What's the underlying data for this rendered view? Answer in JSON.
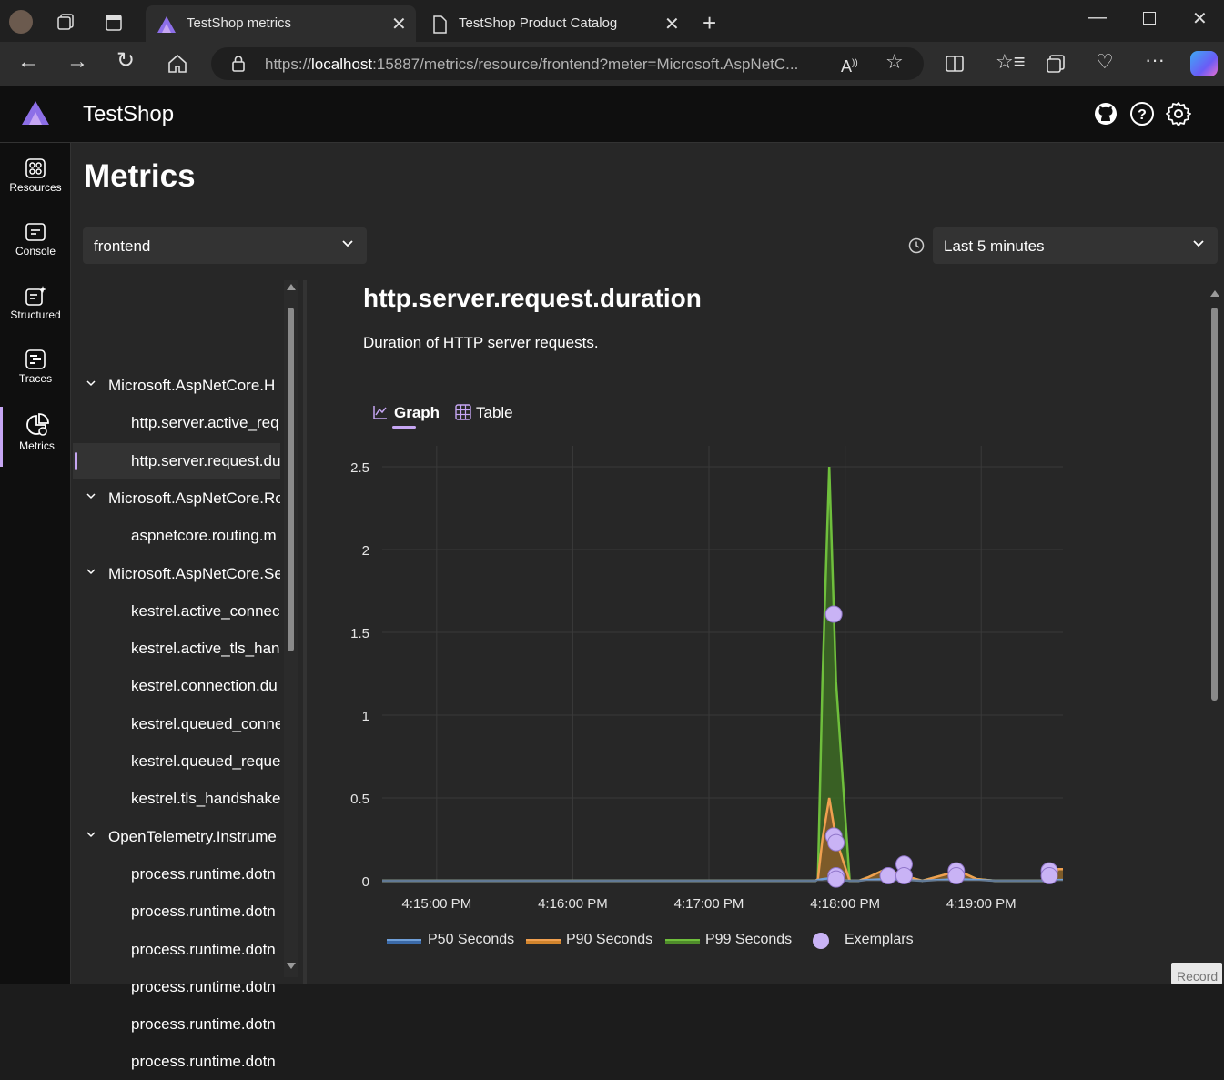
{
  "browser": {
    "tabs": [
      {
        "title": "TestShop metrics",
        "active": true
      },
      {
        "title": "TestShop Product Catalog",
        "active": false
      }
    ],
    "url_prefix": "https://",
    "url_host": "localhost",
    "url_rest": ":15887/metrics/resource/frontend?meter=Microsoft.AspNetC..."
  },
  "app": {
    "title": "TestShop",
    "page_title": "Metrics"
  },
  "nav": {
    "items": [
      {
        "label": "Resources",
        "icon": "resources-icon"
      },
      {
        "label": "Console",
        "icon": "console-icon"
      },
      {
        "label": "Structured",
        "icon": "structured-icon"
      },
      {
        "label": "Traces",
        "icon": "traces-icon"
      },
      {
        "label": "Metrics",
        "icon": "metrics-icon",
        "active": true
      }
    ]
  },
  "resource_select": {
    "value": "frontend"
  },
  "time_select": {
    "value": "Last 5 minutes"
  },
  "tree": [
    {
      "label": "Microsoft.AspNetCore.H",
      "level": 0
    },
    {
      "label": "http.server.active_req",
      "level": 1
    },
    {
      "label": "http.server.request.du",
      "level": 1,
      "selected": true
    },
    {
      "label": "Microsoft.AspNetCore.Ro",
      "level": 0
    },
    {
      "label": "aspnetcore.routing.m",
      "level": 1
    },
    {
      "label": "Microsoft.AspNetCore.Se",
      "level": 0
    },
    {
      "label": "kestrel.active_connec",
      "level": 1
    },
    {
      "label": "kestrel.active_tls_hand",
      "level": 1
    },
    {
      "label": "kestrel.connection.du",
      "level": 1
    },
    {
      "label": "kestrel.queued_conne",
      "level": 1
    },
    {
      "label": "kestrel.queued_reque",
      "level": 1
    },
    {
      "label": "kestrel.tls_handshake",
      "level": 1
    },
    {
      "label": "OpenTelemetry.Instrume",
      "level": 0
    },
    {
      "label": "process.runtime.dotn",
      "level": 1
    },
    {
      "label": "process.runtime.dotn",
      "level": 1
    },
    {
      "label": "process.runtime.dotn",
      "level": 1
    },
    {
      "label": "process.runtime.dotn",
      "level": 1
    },
    {
      "label": "process.runtime.dotn",
      "level": 1
    },
    {
      "label": "process.runtime.dotn",
      "level": 1
    }
  ],
  "metric": {
    "name": "http.server.request.duration",
    "description": "Duration of HTTP server requests."
  },
  "view_tabs": {
    "graph": "Graph",
    "table": "Table"
  },
  "record_label": "Record",
  "colors": {
    "accent": "#c6a6f3",
    "p50": "#3b6aa8",
    "p90": "#d1842d",
    "p99": "#4f8c2b",
    "exemplar": "#c9b3f5"
  },
  "chart_data": {
    "type": "area",
    "x_tick_labels": [
      "4:15:00 PM",
      "4:16:00 PM",
      "4:17:00 PM",
      "4:18:00 PM",
      "4:19:00 PM"
    ],
    "x_ticks_min": [
      0,
      60,
      120,
      180,
      240
    ],
    "xlim_min": [
      -24,
      276
    ],
    "y_tick_labels": [
      "0",
      "0.5",
      "1",
      "1.5",
      "2",
      "2.5"
    ],
    "y_ticks": [
      0,
      0.5,
      1,
      1.5,
      2,
      2.5
    ],
    "ylim": [
      0,
      2.5
    ],
    "grid": true,
    "legend_position": "bottom",
    "series": [
      {
        "name": "P50 Seconds",
        "color": "#3b6aa8",
        "x": [
          -24,
          167,
          168,
          170,
          173,
          176,
          182,
          186,
          190,
          198,
          206,
          214,
          222,
          230,
          238,
          246,
          254,
          262,
          270,
          274,
          276
        ],
        "y": [
          0,
          0,
          0.005,
          0.01,
          0.015,
          0.005,
          0,
          0,
          0.005,
          0.01,
          0.005,
          0,
          0.005,
          0.01,
          0.005,
          0,
          0,
          0,
          0,
          0.005,
          0.005
        ]
      },
      {
        "name": "P90 Seconds",
        "color": "#d1842d",
        "x": [
          -24,
          167,
          168,
          170,
          173,
          176,
          182,
          186,
          190,
          198,
          206,
          214,
          222,
          230,
          238,
          246,
          254,
          262,
          270,
          274,
          276
        ],
        "y": [
          0,
          0,
          0.01,
          0.25,
          0.5,
          0.25,
          0,
          0,
          0.02,
          0.07,
          0.03,
          0,
          0.03,
          0.06,
          0.01,
          0,
          0,
          0,
          0,
          0.07,
          0.07
        ]
      },
      {
        "name": "P99 Seconds",
        "color": "#4f8c2b",
        "x": [
          -24,
          167,
          168,
          170,
          173,
          176,
          182,
          186,
          190,
          198,
          206,
          214,
          222,
          230,
          238,
          246,
          254,
          262,
          270,
          274,
          276
        ],
        "y": [
          0,
          0,
          0.01,
          1.2,
          2.5,
          1.2,
          0,
          0,
          0.02,
          0.07,
          0.03,
          0,
          0.03,
          0.06,
          0.01,
          0,
          0,
          0,
          0,
          0.07,
          0.07
        ]
      }
    ],
    "exemplars": {
      "name": "Exemplars",
      "x": [
        175,
        175,
        176,
        176,
        176,
        199,
        206,
        206,
        229,
        229,
        270,
        270
      ],
      "y": [
        1.61,
        0.27,
        0.23,
        0.03,
        0.01,
        0.03,
        0.1,
        0.03,
        0.06,
        0.03,
        0.06,
        0.03
      ]
    }
  }
}
